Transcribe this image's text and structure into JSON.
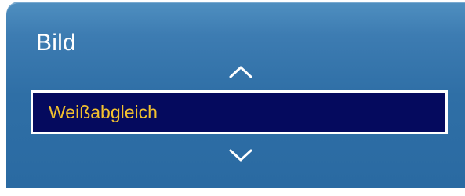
{
  "menu": {
    "title": "Bild",
    "selected_item": "Weißabgleich"
  },
  "icons": {
    "up": "chevron-up-icon",
    "down": "chevron-down-icon"
  },
  "colors": {
    "panel_gradient_top": "#4f8fc0",
    "panel_gradient_bottom": "#2a6aa2",
    "selection_background": "#050a5e",
    "selection_border": "#ffffff",
    "selection_text": "#f2c12e",
    "title_text": "#ffffff"
  }
}
